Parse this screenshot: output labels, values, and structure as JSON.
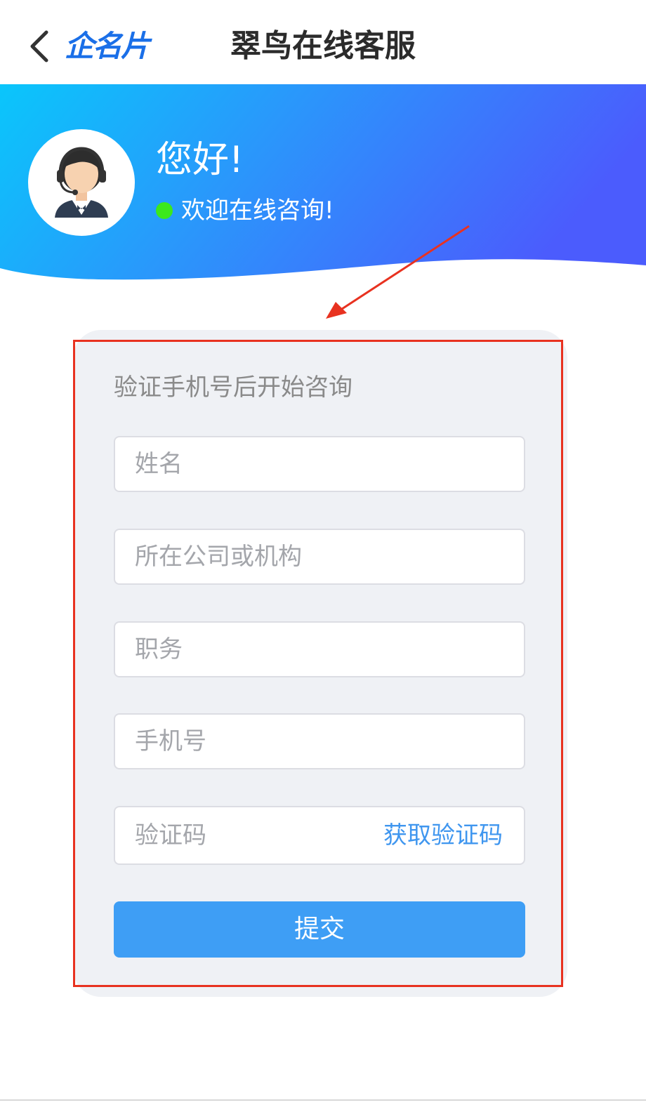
{
  "nav": {
    "logo_text": "企名片",
    "title": "翠鸟在线客服",
    "back_icon": "chevron-left-icon"
  },
  "header": {
    "greeting": "您好!",
    "welcome": "欢迎在线咨询!",
    "status_color": "#3ce81d",
    "gradient_start": "#0ac6fb",
    "gradient_end": "#4b5cfd",
    "avatar_icon": "customer-service-agent-icon"
  },
  "form": {
    "title": "验证手机号后开始咨询",
    "fields": {
      "name_placeholder": "姓名",
      "company_placeholder": "所在公司或机构",
      "position_placeholder": "职务",
      "phone_placeholder": "手机号",
      "code_placeholder": "验证码"
    },
    "get_code_label": "获取验证码",
    "submit_label": "提交",
    "accent_color": "#3e9ef5"
  },
  "annotation": {
    "highlight_color": "#e83220"
  }
}
